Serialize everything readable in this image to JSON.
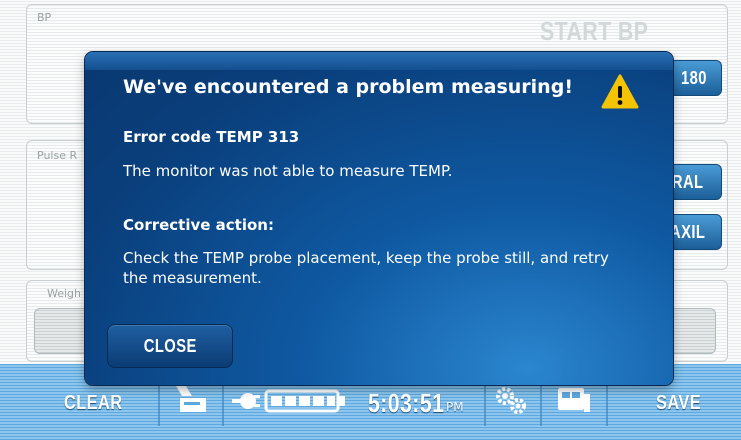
{
  "background": {
    "bp_label": "BP",
    "start_bp_label": "START BP",
    "pulse_label": "Pulse R",
    "weight_label": "Weigh",
    "side_buttons": [
      "180",
      "ORAL",
      "AXIL"
    ]
  },
  "bottom_bar": {
    "clear_label": "CLEAR",
    "time": "5:03:51",
    "ampm": "PM",
    "save_label": "SAVE",
    "icons": [
      "printer-icon",
      "power-plug-icon",
      "battery-icon",
      "settings-gears-icon",
      "network-card-icon"
    ]
  },
  "dialog": {
    "title": "We've encountered a problem measuring!",
    "error_code": "Error code TEMP 313",
    "error_message": "The monitor was not able to measure TEMP.",
    "corrective_heading": "Corrective action:",
    "corrective_text": "Check the TEMP probe placement, keep the probe still, and retry the measurement.",
    "close_label": "CLOSE",
    "warning_color": "#f5c400"
  }
}
